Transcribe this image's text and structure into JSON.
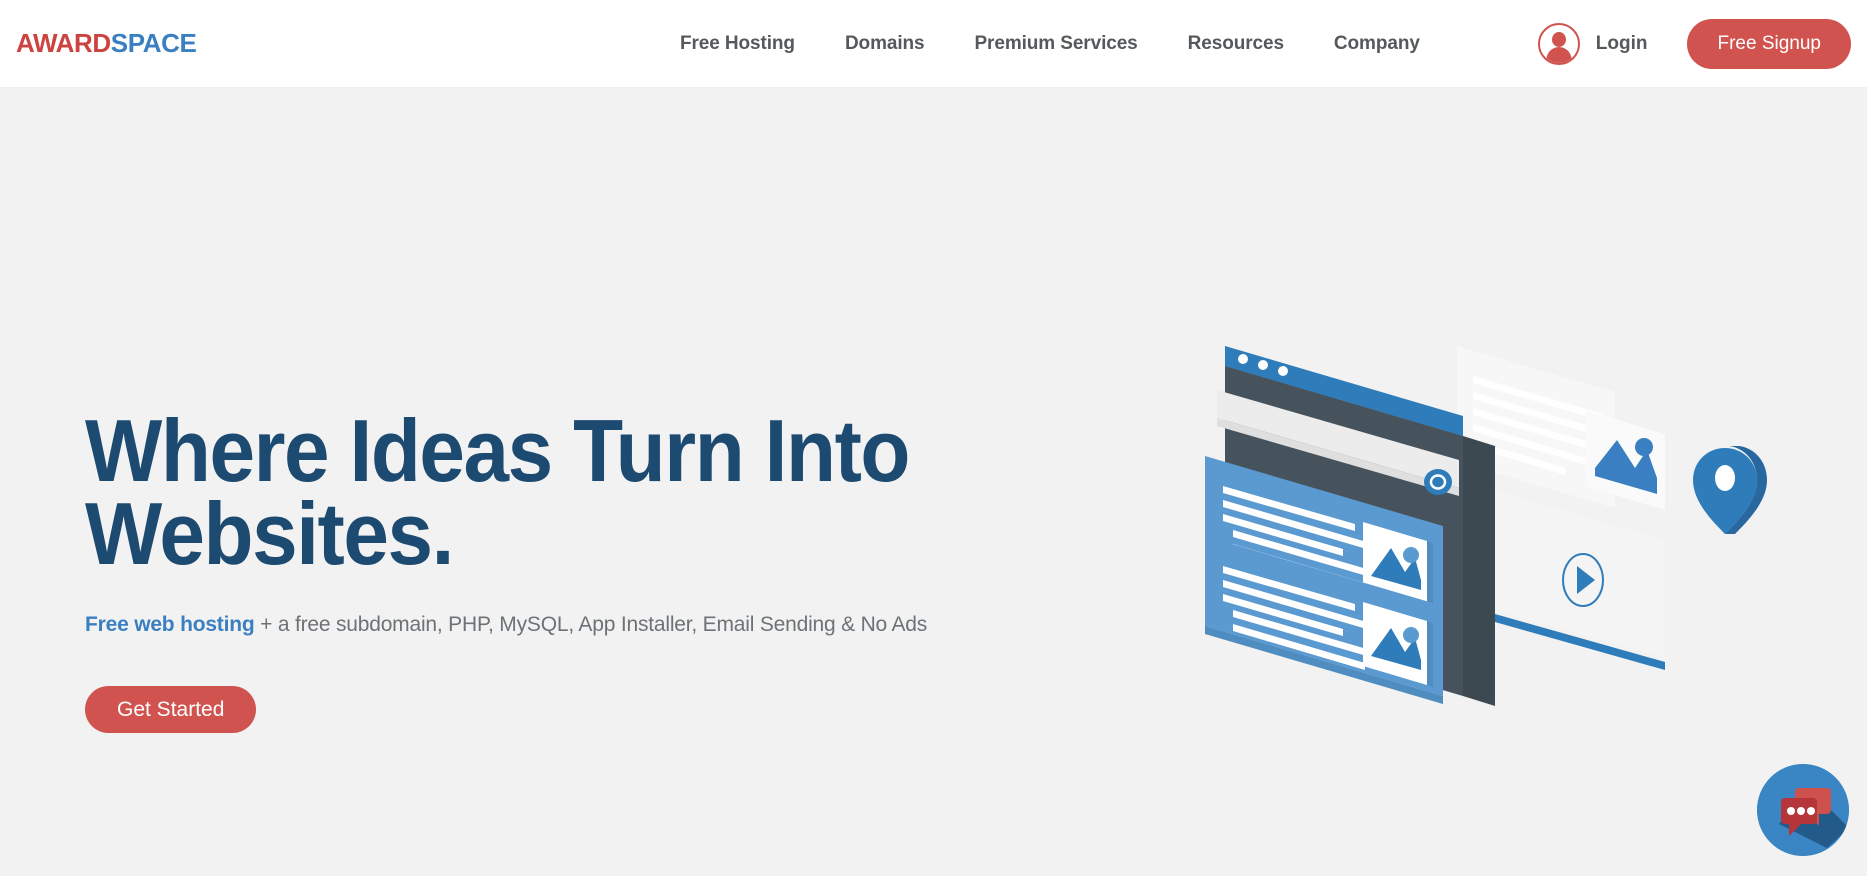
{
  "brand": {
    "logo_part1": "AWARD",
    "logo_part2": "SPACE",
    "color_red": "#d1534f",
    "color_blue": "#3a7fc1",
    "color_navy": "#1d4a70"
  },
  "header": {
    "nav_items": [
      {
        "label": "Free Hosting",
        "name": "nav-item-free-hosting"
      },
      {
        "label": "Domains",
        "name": "nav-item-domains"
      },
      {
        "label": "Premium Services",
        "name": "nav-item-premium-services"
      },
      {
        "label": "Resources",
        "name": "nav-item-resources"
      },
      {
        "label": "Company",
        "name": "nav-item-company"
      }
    ],
    "login_label": "Login",
    "signup_label": "Free Signup"
  },
  "hero": {
    "title": "Where Ideas Turn Into\nWebsites.",
    "subtitle_accent": "Free web hosting",
    "subtitle_rest": " + a free subdomain, PHP, MySQL, App Installer, Email Sending & No Ads",
    "cta_label": "Get Started"
  },
  "chat": {
    "label": "chat-widget"
  }
}
